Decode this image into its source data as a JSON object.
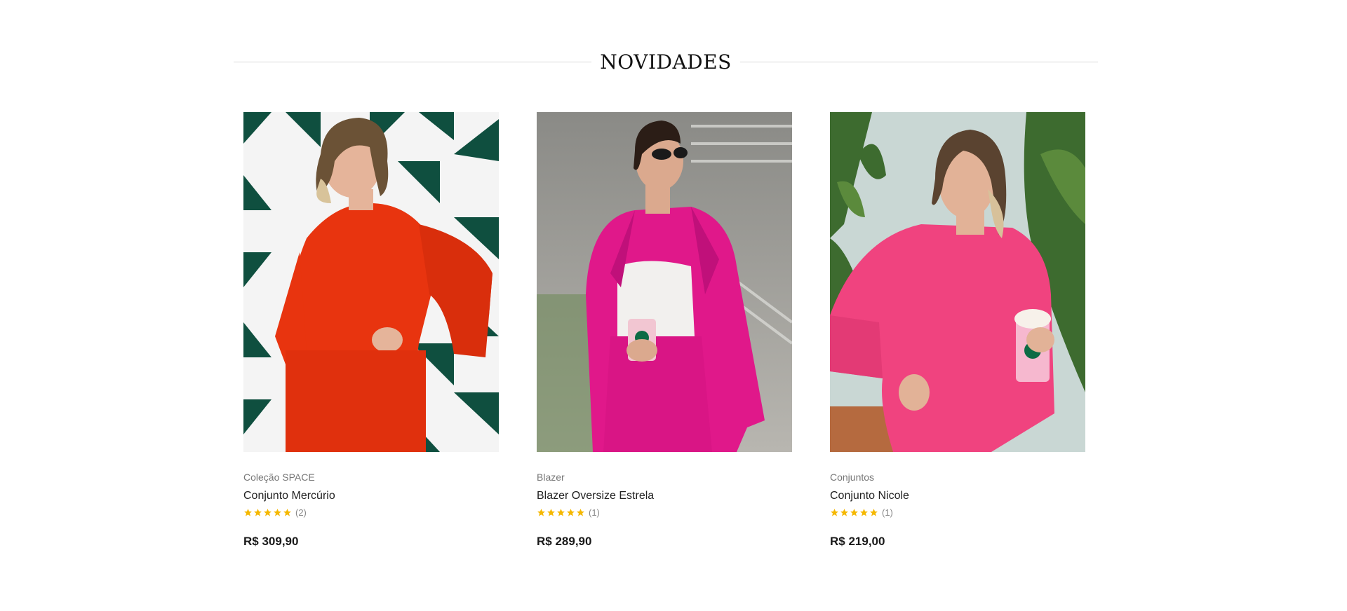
{
  "section": {
    "title": "NOVIDADES"
  },
  "products": [
    {
      "category": "Coleção SPACE",
      "name": "Conjunto Mercúrio",
      "rating": 5,
      "rating_count": "(2)",
      "price": "R$ 309,90",
      "image_description_colors": {
        "outfit": "#e8340f",
        "background": "#0f4f3f"
      }
    },
    {
      "category": "Blazer",
      "name": "Blazer Oversize Estrela",
      "rating": 5,
      "rating_count": "(1)",
      "price": "R$ 289,90",
      "image_description_colors": {
        "outfit": "#e0188a",
        "background": "#9c9c98"
      }
    },
    {
      "category": "Conjuntos",
      "name": "Conjunto Nicole",
      "rating": 5,
      "rating_count": "(1)",
      "price": "R$ 219,00",
      "image_description_colors": {
        "outfit": "#f0437f",
        "background": "#3d6b2f"
      }
    }
  ],
  "colors": {
    "star": "#f5b800",
    "price": "#1a1a1a",
    "category": "#777777"
  }
}
